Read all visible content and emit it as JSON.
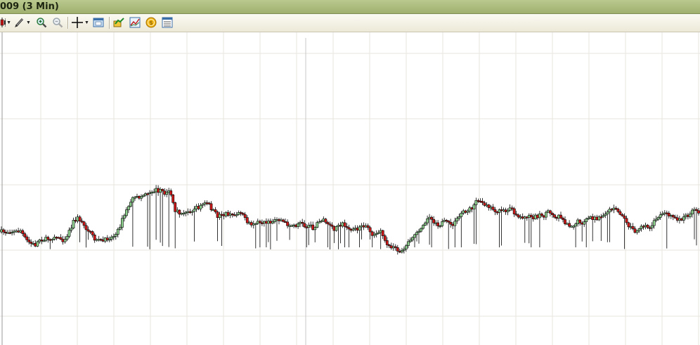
{
  "window": {
    "title": "009 (3 Min)"
  },
  "toolbar": {
    "buttons": [
      {
        "name": "bar-style-button",
        "icon": "candlestick-icon",
        "dropdown": true
      },
      {
        "name": "draw-tool-button",
        "icon": "pencil-icon",
        "dropdown": true
      },
      {
        "name": "zoom-in-button",
        "icon": "zoom-in-icon"
      },
      {
        "name": "zoom-out-button",
        "icon": "zoom-out-icon"
      },
      {
        "name": "crosshair-button",
        "icon": "crosshair-icon",
        "dropdown": true
      },
      {
        "name": "chart-properties-button",
        "icon": "chart-window-icon"
      },
      {
        "name": "strategies-button",
        "icon": "strategy-icon"
      },
      {
        "name": "indicators-button",
        "icon": "indicator-icon"
      },
      {
        "name": "order-button",
        "icon": "coin-icon"
      },
      {
        "name": "data-box-button",
        "icon": "table-icon"
      }
    ]
  },
  "colors": {
    "up": "#8ed08e",
    "down": "#d01818",
    "wick": "#000000",
    "grid": "#e8e6df",
    "cursor": "#c8c8c8"
  },
  "chart_data": {
    "type": "candlestick",
    "title": "009 (3 Min)",
    "grid": true,
    "y_scale_visible": false,
    "price_path": [
      330,
      330,
      329,
      330,
      328,
      341,
      346,
      349,
      340,
      341,
      339,
      337,
      338,
      342,
      330,
      315,
      310,
      320,
      327,
      337,
      342,
      344,
      340,
      337,
      333,
      315,
      300,
      285,
      282,
      280,
      275,
      272,
      270,
      272,
      275,
      270,
      300,
      303,
      305,
      300,
      298,
      295,
      290,
      290,
      300,
      308,
      305,
      305,
      307,
      303,
      300,
      318,
      320,
      317,
      315,
      318,
      316,
      313,
      312,
      318,
      320,
      322,
      316,
      322,
      322,
      325,
      314,
      313,
      320,
      326,
      323,
      318,
      326,
      328,
      327,
      320,
      321,
      332,
      335,
      330,
      345,
      352,
      355,
      357,
      350,
      340,
      332,
      325,
      315,
      310,
      315,
      320,
      316,
      318,
      320,
      310,
      300,
      300,
      295,
      282,
      290,
      290,
      297,
      300,
      302,
      301,
      297,
      305,
      310,
      306,
      310,
      308,
      306,
      307,
      300,
      310,
      305,
      315,
      320,
      320,
      315,
      318,
      310,
      310,
      312,
      305,
      300,
      297,
      300,
      305,
      318,
      325,
      330,
      325,
      322,
      325,
      312,
      305,
      305,
      305,
      312,
      312,
      310,
      305,
      300,
      305
    ]
  }
}
